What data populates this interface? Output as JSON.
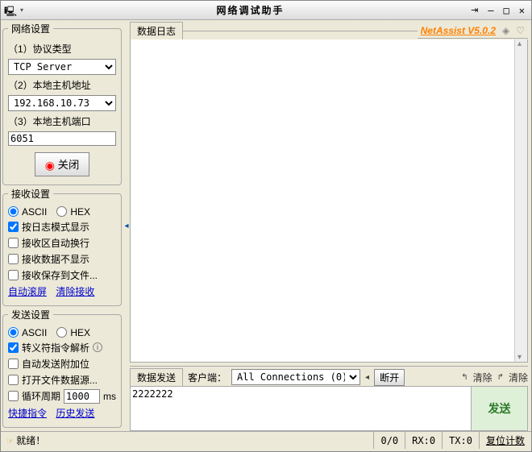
{
  "window": {
    "title": "网络调试助手"
  },
  "brand": "NetAssist V5.0.2",
  "netSettings": {
    "legend": "网络设置",
    "protoLabel": "（1）协议类型",
    "protoValue": "TCP Server",
    "hostLabel": "（2）本地主机地址",
    "hostValue": "192.168.10.73",
    "portLabel": "（3）本地主机端口",
    "portValue": "6051",
    "closeLabel": "关闭"
  },
  "recvSettings": {
    "legend": "接收设置",
    "ascii": "ASCII",
    "hex": "HEX",
    "logMode": "按日志模式显示",
    "autoWrap": "接收区自动换行",
    "hideRecv": "接收数据不显示",
    "saveFile": "接收保存到文件...",
    "autoScroll": "自动滚屏",
    "clearRecv": "清除接收"
  },
  "sendSettings": {
    "legend": "发送设置",
    "ascii": "ASCII",
    "hex": "HEX",
    "escape": "转义符指令解析",
    "autoAppend": "自动发送附加位",
    "openFile": "打开文件数据源...",
    "cycleLabel": "循环周期",
    "cycleValue": "1000",
    "cycleUnit": "ms",
    "shortcut": "快捷指令",
    "history": "历史发送"
  },
  "log": {
    "tab": "数据日志"
  },
  "sendArea": {
    "tab": "数据发送",
    "clientLabel": "客户端：",
    "clientValue": "All Connections (0)",
    "disconnect": "断开",
    "clear1": "清除",
    "clear2": "清除",
    "inputValue": "2222222",
    "sendBtn": "发送"
  },
  "status": {
    "ready": "就绪！",
    "counts": "0/0",
    "rx": "RX:0",
    "tx": "TX:0",
    "reset": "复位计数"
  }
}
